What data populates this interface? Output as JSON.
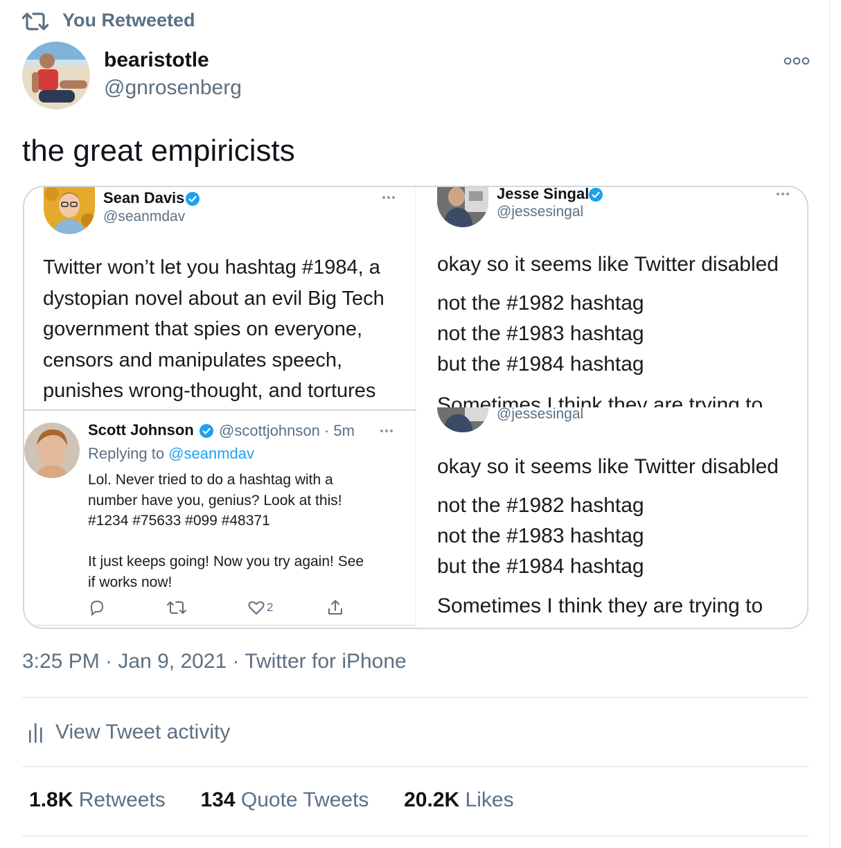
{
  "retweet_label": "You Retweeted",
  "author": {
    "name": "bearistotle",
    "handle": "@gnrosenberg"
  },
  "tweet_text": "the great empiricists",
  "image": {
    "sean": {
      "name": "Sean Davis",
      "handle": "@seanmdav",
      "lines": [
        "Twitter won’t let you hashtag #1984, a",
        "dystopian novel about an evil Big Tech",
        "government that spies on everyone,",
        "censors and manipulates speech,",
        "punishes wrong-thought, and tortures"
      ]
    },
    "scott": {
      "name": "Scott Johnson",
      "meta": "@scottjohnson · 5m",
      "replying_prefix": "Replying to ",
      "replying_to": "@seanmdav",
      "lines": [
        "Lol. Never tried to do a hashtag with a",
        "number have you, genius? Look at this!",
        "#1234 #75633 #099 #48371",
        "",
        "It just keeps going! Now you try again! See",
        "if works now!"
      ],
      "likes": "2"
    },
    "jesse": {
      "name": "Jesse Singal",
      "handle": "@jessesingal",
      "l1": "okay so it seems like Twitter disabled",
      "l2": "not the #1982 hashtag",
      "l3": "not the #1983 hashtag",
      "l4": "but the #1984 hashtag",
      "l5": "Sometimes I think they are trying to"
    }
  },
  "timestamp": "3:25 PM · Jan 9, 2021 · Twitter for iPhone",
  "activity_label": "View Tweet activity",
  "stats": {
    "retweets_count": "1.8K",
    "retweets_label": "Retweets",
    "quotes_count": "134",
    "quotes_label": "Quote Tweets",
    "likes_count": "20.2K",
    "likes_label": "Likes"
  },
  "colors": {
    "accent": "#1da1f2",
    "secondary_text": "#5b7083",
    "border": "#cfd9de"
  }
}
